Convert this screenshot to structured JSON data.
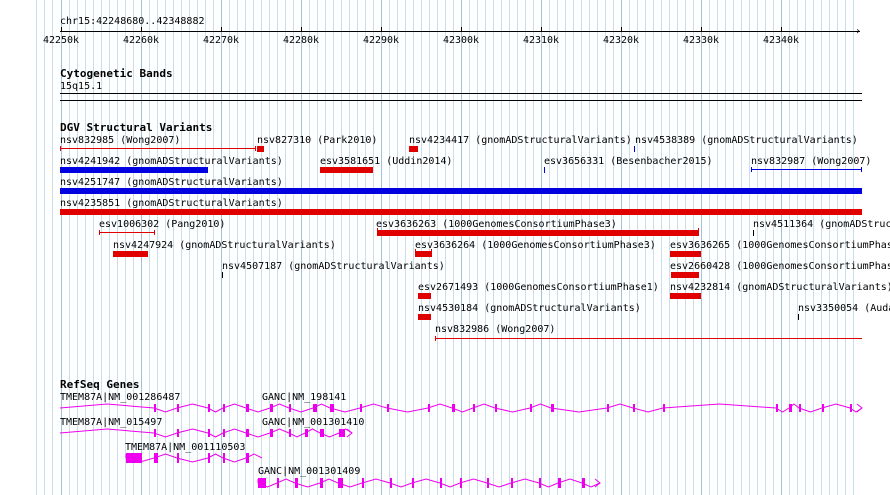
{
  "ruler": {
    "location": "chr15:42248680..42348882",
    "ticks": [
      "42250k",
      "42260k",
      "42270k",
      "42280k",
      "42290k",
      "42300k",
      "42310k",
      "42320k",
      "42330k",
      "42340k"
    ]
  },
  "cytobands": {
    "title": "Cytogenetic Bands",
    "band": "15q15.1"
  },
  "dgv": {
    "title": "DGV Structural Variants",
    "features": [
      {
        "label": "nsv832985 (Wong2007)",
        "color": "#e00000"
      },
      {
        "label": "nsv827310 (Park2010)",
        "color": "#e00000"
      },
      {
        "label": "nsv4234417 (gnomADStructuralVariants)",
        "color": "#e00000"
      },
      {
        "label": "nsv4538389 (gnomADStructuralVariants)",
        "color": "#0000e0"
      },
      {
        "label": "nsv4241942 (gnomADStructuralVariants)",
        "color": "#0000e0"
      },
      {
        "label": "esv3581651 (Uddin2014)",
        "color": "#e00000"
      },
      {
        "label": "esv3656331 (Besenbacher2015)",
        "color": "#0000e0"
      },
      {
        "label": "nsv832987 (Wong2007)",
        "color": "#0000e0"
      },
      {
        "label": "nsv4251747 (gnomADStructuralVariants)",
        "color": "#0000e0"
      },
      {
        "label": "nsv4235851 (gnomADStructuralVariants)",
        "color": "#e00000"
      },
      {
        "label": "esv1006302 (Pang2010)",
        "color": "#e00000"
      },
      {
        "label": "esv3636263 (1000GenomesConsortiumPhase3)",
        "color": "#e00000"
      },
      {
        "label": "nsv4511364 (gnomADStruc",
        "color": "#000000"
      },
      {
        "label": "nsv4247924 (gnomADStructuralVariants)",
        "color": "#e00000"
      },
      {
        "label": "esv3636264 (1000GenomesConsortiumPhase3)",
        "color": "#e00000"
      },
      {
        "label": "esv3636265 (1000GenomesConsortiumPhas",
        "color": "#e00000"
      },
      {
        "label": "nsv4507187 (gnomADStructuralVariants)",
        "color": "#000000"
      },
      {
        "label": "esv2660428 (1000GenomesConsortiumPhas",
        "color": "#e00000"
      },
      {
        "label": "esv2671493 (1000GenomesConsortiumPhase1)",
        "color": "#e00000"
      },
      {
        "label": "nsv4232814 (gnomADStructuralVariants)",
        "color": "#e00000"
      },
      {
        "label": "nsv4530184 (gnomADStructuralVariants)",
        "color": "#e00000"
      },
      {
        "label": "nsv3350054 (Auda",
        "color": "#000000"
      },
      {
        "label": "nsv832986 (Wong2007)",
        "color": "#e00000"
      }
    ]
  },
  "refseq": {
    "title": "RefSeq Genes",
    "color": "#ee00ee",
    "genes": [
      {
        "label": "TMEM87A|NM_001286487"
      },
      {
        "label": "GANC|NM_198141"
      },
      {
        "label": "TMEM87A|NM_015497"
      },
      {
        "label": "GANC|NM_001301410"
      },
      {
        "label": "TMEM87A|NM_001110503"
      },
      {
        "label": "GANC|NM_001301409"
      }
    ]
  }
}
